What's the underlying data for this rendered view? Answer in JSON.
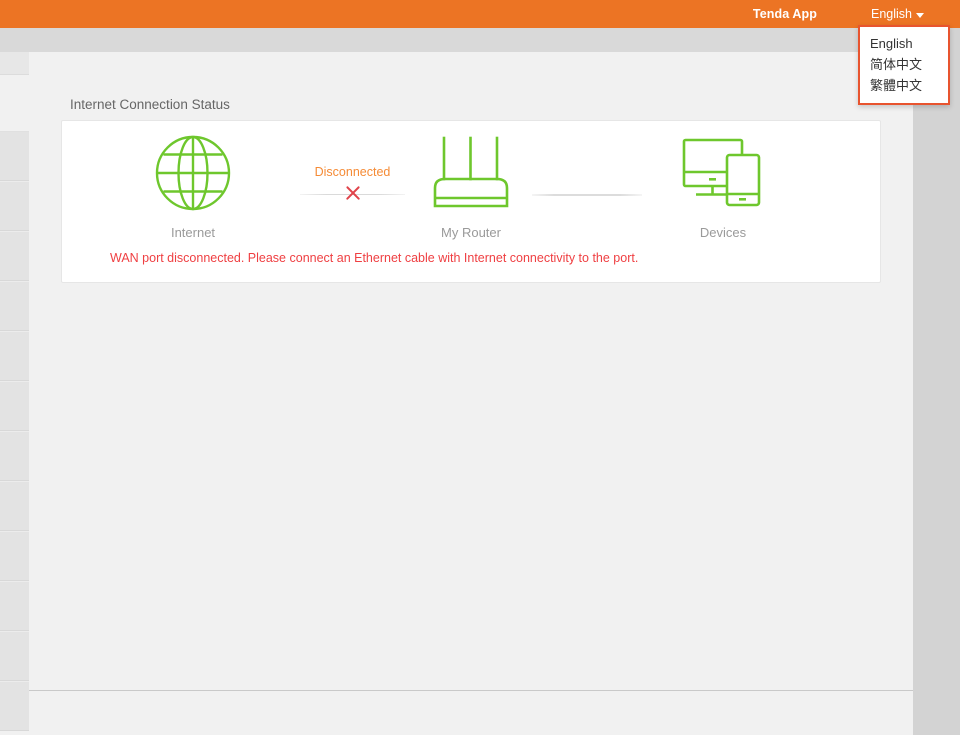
{
  "topbar": {
    "app_link_label": "Tenda App",
    "language_label": "English",
    "caret_icon": "chevron-down-icon",
    "background_color": "#ec7424",
    "text_color": "#ffffff"
  },
  "language_menu": {
    "open": true,
    "border_color": "#e8542f",
    "items": [
      {
        "label": "English",
        "value": "en"
      },
      {
        "label": "简体中文",
        "value": "zh-CN"
      },
      {
        "label": "繁體中文",
        "value": "zh-TW"
      }
    ]
  },
  "sidebar": {
    "items": [
      {
        "label": ""
      },
      {
        "label": ""
      },
      {
        "label": ""
      },
      {
        "label": ""
      },
      {
        "label": ""
      },
      {
        "label": ""
      },
      {
        "label": ""
      },
      {
        "label": ""
      },
      {
        "label": ""
      },
      {
        "label": ""
      },
      {
        "label": ""
      },
      {
        "label": ""
      }
    ]
  },
  "main": {
    "section_title": "Internet Connection Status",
    "topology": {
      "internet": {
        "label": "Internet",
        "icon": "globe-icon",
        "icon_color": "#6ec72d"
      },
      "router": {
        "label": "My Router",
        "icon": "router-icon",
        "icon_color": "#6ec72d"
      },
      "devices": {
        "label": "Devices",
        "icon": "devices-icon",
        "icon_color": "#6ec72d"
      },
      "link_internet_router": {
        "status_text": "Disconnected",
        "status_color": "#f58b36",
        "state_icon": "cross-icon",
        "state_icon_color": "#e0434a"
      },
      "link_router_devices": {
        "status_text": "",
        "state_icon": "line-icon"
      }
    },
    "warning_message": "WAN port disconnected. Please connect an Ethernet cable with Internet connectivity to the port.",
    "warning_color": "#ef3f42"
  }
}
